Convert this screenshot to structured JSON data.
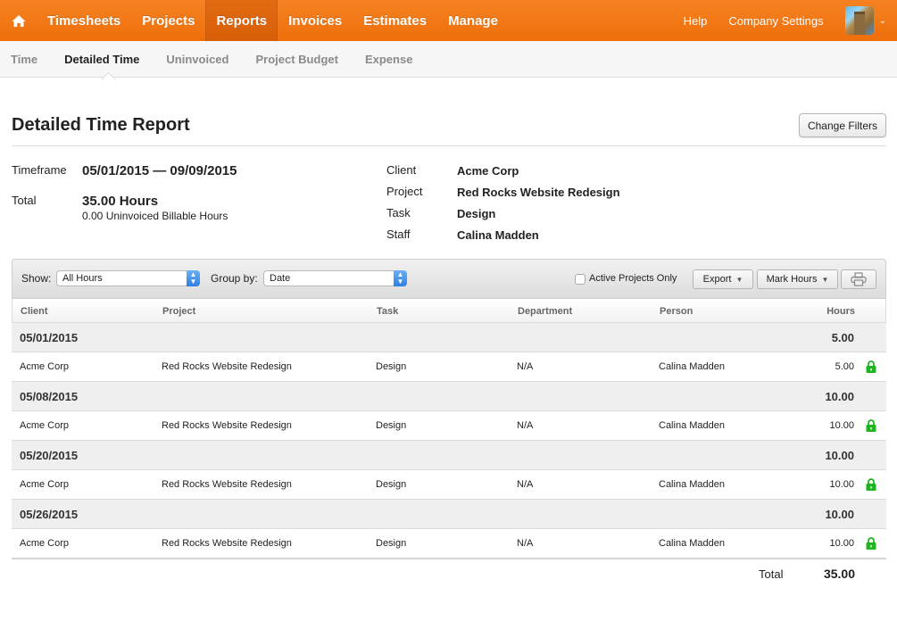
{
  "topnav": {
    "items": [
      {
        "label": "Timesheets",
        "active": false
      },
      {
        "label": "Projects",
        "active": false
      },
      {
        "label": "Reports",
        "active": true
      },
      {
        "label": "Invoices",
        "active": false
      },
      {
        "label": "Estimates",
        "active": false
      },
      {
        "label": "Manage",
        "active": false
      }
    ],
    "help": "Help",
    "company_settings": "Company Settings",
    "accent_color": "#f27a16"
  },
  "subnav": {
    "items": [
      {
        "label": "Time",
        "active": false
      },
      {
        "label": "Detailed Time",
        "active": true
      },
      {
        "label": "Uninvoiced",
        "active": false
      },
      {
        "label": "Project Budget",
        "active": false
      },
      {
        "label": "Expense",
        "active": false
      }
    ]
  },
  "page": {
    "title": "Detailed Time Report",
    "change_filters": "Change Filters"
  },
  "summary": {
    "timeframe_label": "Timeframe",
    "timeframe_value": "05/01/2015 — 09/09/2015",
    "total_label": "Total",
    "total_value": "35.00 Hours",
    "total_sub": "0.00 Uninvoiced Billable Hours"
  },
  "filters": {
    "client_label": "Client",
    "client_value": "Acme Corp",
    "project_label": "Project",
    "project_value": "Red Rocks Website Redesign",
    "task_label": "Task",
    "task_value": "Design",
    "staff_label": "Staff",
    "staff_value": "Calina Madden"
  },
  "toolbar": {
    "show_label": "Show:",
    "show_value": "All Hours",
    "group_label": "Group by:",
    "group_value": "Date",
    "active_only_label": "Active Projects Only",
    "active_only_checked": false,
    "export_label": "Export",
    "mark_hours_label": "Mark Hours"
  },
  "table": {
    "columns": [
      "Client",
      "Project",
      "Task",
      "Department",
      "Person",
      "Hours"
    ],
    "groups": [
      {
        "date": "05/01/2015",
        "hours": "5.00",
        "entry": {
          "client": "Acme Corp",
          "project": "Red Rocks Website Redesign",
          "task": "Design",
          "department": "N/A",
          "person": "Calina Madden",
          "hours": "5.00",
          "locked": true
        }
      },
      {
        "date": "05/08/2015",
        "hours": "10.00",
        "entry": {
          "client": "Acme Corp",
          "project": "Red Rocks Website Redesign",
          "task": "Design",
          "department": "N/A",
          "person": "Calina Madden",
          "hours": "10.00",
          "locked": true
        }
      },
      {
        "date": "05/20/2015",
        "hours": "10.00",
        "entry": {
          "client": "Acme Corp",
          "project": "Red Rocks Website Redesign",
          "task": "Design",
          "department": "N/A",
          "person": "Calina Madden",
          "hours": "10.00",
          "locked": true
        }
      },
      {
        "date": "05/26/2015",
        "hours": "10.00",
        "entry": {
          "client": "Acme Corp",
          "project": "Red Rocks Website Redesign",
          "task": "Design",
          "department": "N/A",
          "person": "Calina Madden",
          "hours": "10.00",
          "locked": true
        }
      }
    ],
    "total_label": "Total",
    "total_value": "35.00",
    "lock_color": "#1fb51f"
  }
}
